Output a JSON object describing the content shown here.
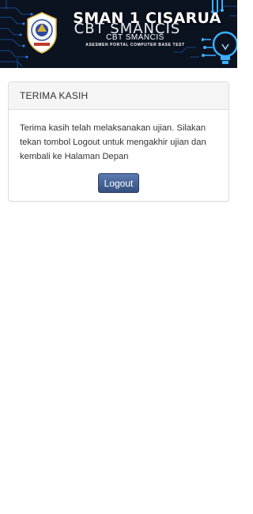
{
  "header": {
    "school_name": "SMAN 1 CISARUA",
    "ghost_title": "CBT SMANCIS",
    "app_subtitle": "CBT SMANCIS",
    "tagline": "ASESMEN PORTAL COMPUTER BASE TEST",
    "logo_icon": "school-emblem-icon",
    "decor_icon": "lightbulb-circuit-icon"
  },
  "panel": {
    "heading": "TERIMA KASIH",
    "message": "Terima kasih telah melaksanakan ujian. Silakan tekan tombol Logout untuk mengakhir ujian dan kembali ke Halaman Depan",
    "logout_label": "Logout"
  },
  "colors": {
    "banner_bg": "#0b1220",
    "panel_heading_bg": "#f5f5f5",
    "button_bg": "#3d5a8a",
    "circuit": "#1f6fd6"
  }
}
